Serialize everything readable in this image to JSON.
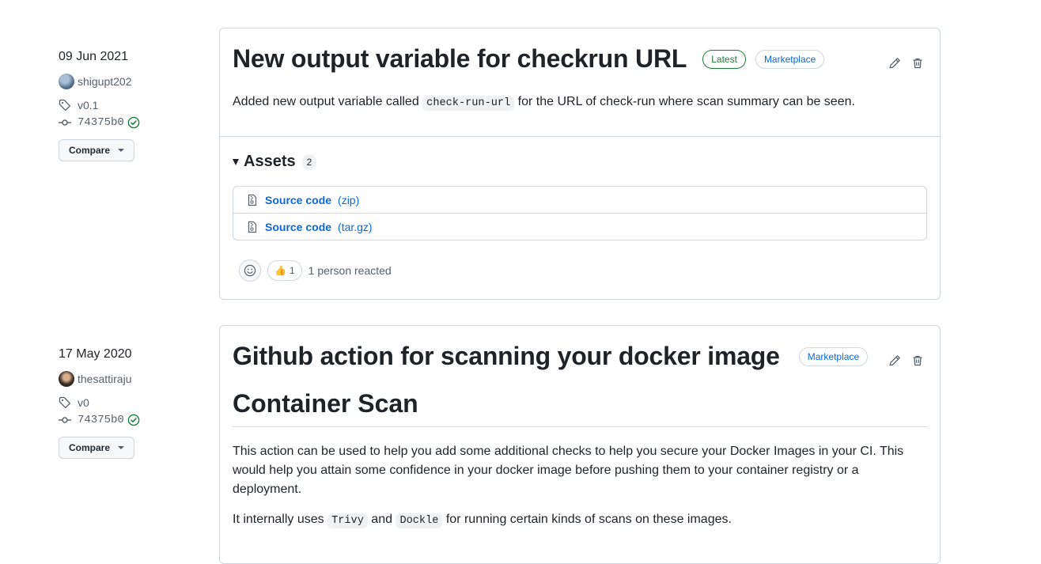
{
  "releases": [
    {
      "date": "09 Jun 2021",
      "author": "shigupt202",
      "tag": "v0.1",
      "commit": "74375b0",
      "compare_label": "Compare",
      "title": "New output variable for checkrun URL",
      "badges": {
        "latest": "Latest",
        "marketplace": "Marketplace"
      },
      "body": {
        "before": "Added new output variable called ",
        "code": "check-run-url",
        "after": " for the URL of check-run where scan summary can be seen."
      },
      "assets": {
        "heading": "Assets",
        "count": "2",
        "items": [
          {
            "name": "Source code",
            "ext": "(zip)"
          },
          {
            "name": "Source code",
            "ext": "(tar.gz)"
          }
        ]
      },
      "reactions": {
        "emoji": "👍",
        "count": "1",
        "summary": "1 person reacted"
      }
    },
    {
      "date": "17 May 2020",
      "author": "thesattiraju",
      "tag": "v0",
      "commit": "74375b0",
      "compare_label": "Compare",
      "title": "Github action for scanning your docker image",
      "badges": {
        "marketplace": "Marketplace"
      },
      "heading": "Container Scan",
      "paragraph": "This action can be used to help you add some additional checks to help you secure your Docker Images in your CI. This would help you attain some confidence in your docker image before pushing them to your container registry or a deployment.",
      "line2": {
        "before": "It internally uses ",
        "code1": "Trivy",
        "mid": " and ",
        "code2": "Dockle",
        "after": " for running certain kinds of scans on these images."
      }
    }
  ],
  "colors": {
    "link": "#0969da",
    "success": "#1a7f37",
    "border": "#d0d7de",
    "muted": "#57606a"
  },
  "icons": [
    "tag-icon",
    "commit-icon",
    "check-circle-icon",
    "pencil-icon",
    "trash-icon",
    "file-zip-icon",
    "smiley-icon"
  ]
}
